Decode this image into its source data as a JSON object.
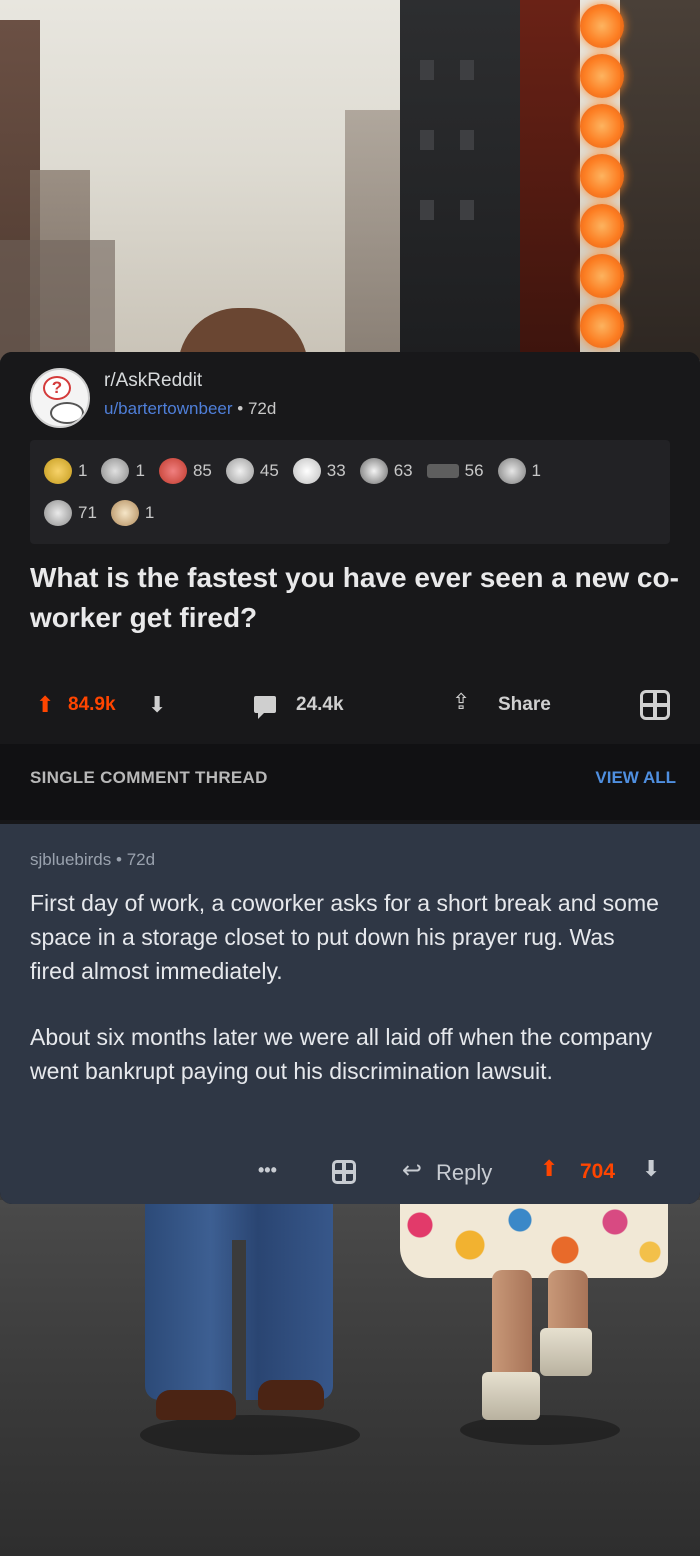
{
  "post": {
    "subreddit": "r/AskReddit",
    "author": "u/bartertownbeer",
    "separator": "•",
    "age": "72d",
    "awards": [
      {
        "icon": "gold-award-icon",
        "count": "1"
      },
      {
        "icon": "platinum-award-icon",
        "count": "1"
      },
      {
        "icon": "silver-award-icon",
        "count": "85"
      },
      {
        "icon": "helpful-award-icon",
        "count": "45"
      },
      {
        "icon": "wholesome-award-icon",
        "count": "33"
      },
      {
        "icon": "coin-award-icon",
        "count": "63"
      },
      {
        "icon": "badge-award-icon",
        "count": "56"
      },
      {
        "icon": "face-award-icon",
        "count": "1"
      },
      {
        "icon": "face-award-icon",
        "count": "71"
      },
      {
        "icon": "heart-award-icon",
        "count": "1"
      }
    ],
    "title": "What is the fastest you have ever seen a new co-worker get fired?",
    "score": "84.9k",
    "comments": "24.4k",
    "share_label": "Share"
  },
  "thread": {
    "label": "SINGLE COMMENT THREAD",
    "view_all": "VIEW ALL"
  },
  "comment": {
    "author": "sjbluebirds",
    "separator": "•",
    "age": "72d",
    "paragraph1": "First day of work, a coworker asks for a short break and some space in a storage closet to put down his prayer rug.  Was fired almost immediately.",
    "paragraph2": "About six months later we were all laid off when the company went bankrupt paying out his discrimination lawsuit.",
    "more": "•••",
    "reply_label": "Reply",
    "score": "704"
  },
  "colors": {
    "upvote": "#ff4500",
    "link": "#4f7fd9",
    "card_bg": "#18181a",
    "comment_bg": "#2f3745"
  }
}
